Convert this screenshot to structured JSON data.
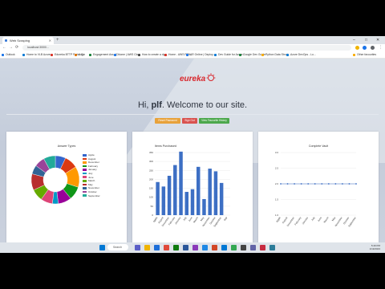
{
  "browser": {
    "tab_title": "Web Scraping",
    "new_tab": "+",
    "url": "localhost:3000/...",
    "win_min": "–",
    "win_max": "□",
    "win_close": "✕",
    "back": "←",
    "forward": "→",
    "reload": "⟳",
    "bookmarks": [
      {
        "label": "Outlook",
        "color": "#1a73e8"
      },
      {
        "label": "Home to VLB Azure",
        "color": "#0078d4"
      },
      {
        "label": "Edureka BTTP Portal C...",
        "color": "#d93025"
      },
      {
        "label": "Login",
        "color": "#e37400"
      },
      {
        "label": "Engagement Ass. (C...",
        "color": "#188038"
      },
      {
        "label": "Home | AWS Clo...",
        "color": "#1a73e8"
      },
      {
        "label": "How to create a dyn...",
        "color": "#444444"
      },
      {
        "label": "Home - AWS PEN...",
        "color": "#d93025"
      },
      {
        "label": "AR Online | Deploy...",
        "color": "#1a73e8"
      },
      {
        "label": "Dev Guide for Azure...",
        "color": "#0078d4"
      },
      {
        "label": "Google Dev Guide...",
        "color": "#188038"
      },
      {
        "label": "Python Data Struct...",
        "color": "#f9ab00"
      },
      {
        "label": "Azure DevOps - Lo...",
        "color": "#0078d4"
      },
      {
        "label": "Other favourites",
        "color": "#f9ab00"
      }
    ]
  },
  "page": {
    "logo_text": "eureka",
    "greeting_prefix": "Hi, ",
    "username": "plf",
    "greeting_suffix": ". Welcome to our site.",
    "buttons": [
      {
        "label": "Reset Password",
        "color": "#e8a23a"
      },
      {
        "label": "Sign Out",
        "color": "#d9534f"
      },
      {
        "label": "View Favourite History",
        "color": "#4ca84c"
      }
    ]
  },
  "charts": {
    "donut": {
      "title": "Answer Types",
      "legend": [
        {
          "label": "Apple",
          "color": "#3366cc"
        },
        {
          "label": "August",
          "color": "#dc3912"
        },
        {
          "label": "December",
          "color": "#ff9900"
        },
        {
          "label": "February",
          "color": "#109618"
        },
        {
          "label": "January",
          "color": "#990099"
        },
        {
          "label": "July",
          "color": "#0099c6"
        },
        {
          "label": "June",
          "color": "#dd4477"
        },
        {
          "label": "March",
          "color": "#66aa00"
        },
        {
          "label": "May",
          "color": "#b82e2e"
        },
        {
          "label": "November",
          "color": "#316395"
        },
        {
          "label": "October",
          "color": "#994499"
        },
        {
          "label": "September",
          "color": "#22aa99"
        }
      ]
    },
    "bar": {
      "title": "Items Purchased",
      "y_ticks": [
        "0",
        "50",
        "100",
        "150",
        "200",
        "250",
        "300",
        "350"
      ]
    },
    "line": {
      "title": "Complete Vault",
      "y_ticks": [
        "1.0",
        "1.5",
        "2.0",
        "2.5",
        "3.0"
      ]
    }
  },
  "chart_data": [
    {
      "type": "pie",
      "title": "Answer Types",
      "labels": [
        "Apple",
        "August",
        "December",
        "February",
        "January",
        "July",
        "June",
        "March",
        "May",
        "November",
        "October",
        "September"
      ],
      "values": [
        7,
        9,
        14,
        9,
        9,
        4,
        8,
        8,
        11,
        6,
        7,
        8
      ]
    },
    {
      "type": "bar",
      "title": "Items Purchased",
      "categories": [
        "Apple",
        "August",
        "December",
        "February",
        "January",
        "July",
        "June",
        "March",
        "May",
        "November",
        "October",
        "September",
        "Sep"
      ],
      "values": [
        185,
        160,
        220,
        280,
        355,
        130,
        145,
        270,
        90,
        260,
        245,
        180,
        0
      ],
      "ylim": [
        0,
        350
      ]
    },
    {
      "type": "line",
      "title": "Complete Vault",
      "categories": [
        "Apple",
        "August",
        "December",
        "February",
        "January",
        "July",
        "June",
        "March",
        "May",
        "November",
        "October",
        "September"
      ],
      "values": [
        2,
        2,
        2,
        2,
        2,
        2,
        2,
        2,
        2,
        2,
        2,
        2
      ],
      "ylim": [
        1,
        3
      ]
    }
  ],
  "taskbar": {
    "search": "Search",
    "time": "5:49 PM",
    "date": "1/19/2023"
  }
}
